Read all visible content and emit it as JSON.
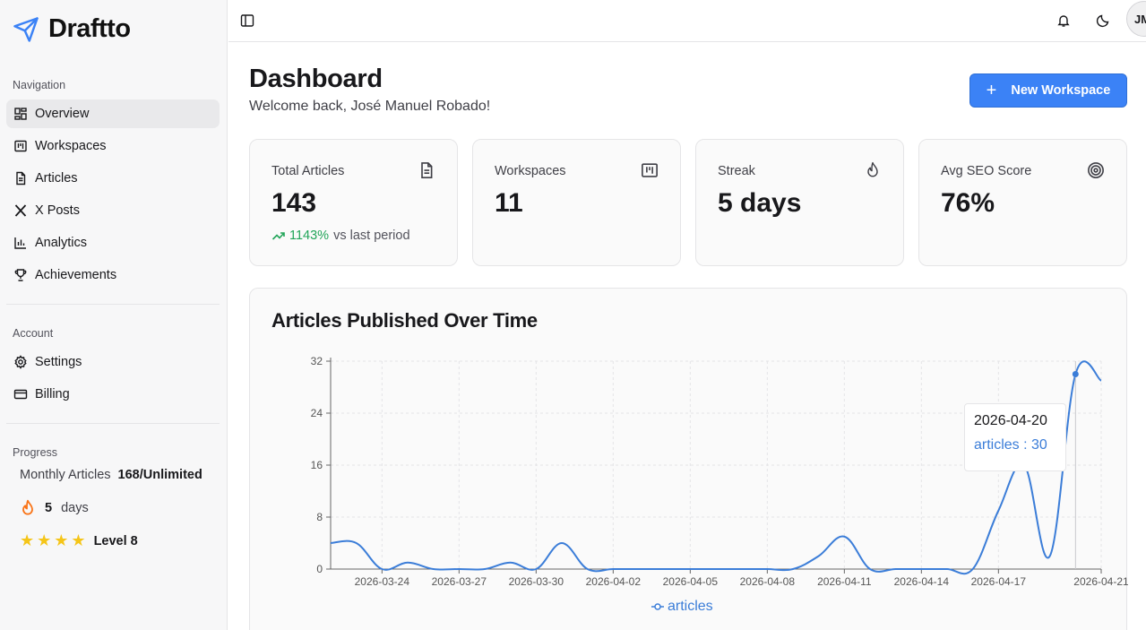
{
  "brand": {
    "name": "Draftto"
  },
  "sidebar": {
    "navigation_label": "Navigation",
    "nav": [
      {
        "label": "Overview",
        "icon": "grid-icon",
        "active": true
      },
      {
        "label": "Workspaces",
        "icon": "kanban-icon"
      },
      {
        "label": "Articles",
        "icon": "file-text-icon"
      },
      {
        "label": "X Posts",
        "icon": "x-logo-icon"
      },
      {
        "label": "Analytics",
        "icon": "bar-chart-icon"
      },
      {
        "label": "Achievements",
        "icon": "trophy-icon"
      }
    ],
    "account_label": "Account",
    "account": [
      {
        "label": "Settings",
        "icon": "gear-icon"
      },
      {
        "label": "Billing",
        "icon": "credit-card-icon"
      }
    ],
    "progress_label": "Progress",
    "progress": {
      "monthly_label": "Monthly Articles",
      "monthly_value": "168/Unlimited",
      "streak_value": "5",
      "streak_unit": "days",
      "level": "Level 8",
      "stars": 4
    }
  },
  "topbar": {
    "avatar_initials": "JM"
  },
  "header": {
    "title": "Dashboard",
    "welcome": "Welcome back, José Manuel Robado!",
    "new_button": "New Workspace"
  },
  "stats": [
    {
      "title": "Total Articles",
      "value": "143",
      "icon": "file-text-icon",
      "trend": "1143%",
      "trend_suffix": "vs last period"
    },
    {
      "title": "Workspaces",
      "value": "11",
      "icon": "kanban-icon"
    },
    {
      "title": "Streak",
      "value": "5 days",
      "icon": "flame-icon"
    },
    {
      "title": "Avg SEO Score",
      "value": "76%",
      "icon": "target-icon"
    }
  ],
  "chart": {
    "title": "Articles Published Over Time",
    "tooltip_date": "2026-04-20",
    "tooltip_value": "articles : 30",
    "legend": "articles"
  },
  "colors": {
    "accent": "#3b82f6",
    "line": "#3b7dd8",
    "trend_up": "#22a559",
    "star": "#f5c518"
  },
  "chart_data": {
    "type": "line",
    "title": "Articles Published Over Time",
    "x_tick_labels": [
      "2026-03-24",
      "2026-03-27",
      "2026-03-30",
      "2026-04-02",
      "2026-04-05",
      "2026-04-08",
      "2026-04-11",
      "2026-04-14",
      "2026-04-17",
      "2026-04-21"
    ],
    "y_ticks": [
      0,
      8,
      16,
      24,
      32
    ],
    "ylim": [
      0,
      32
    ],
    "grid": true,
    "legend_position": "bottom",
    "series": [
      {
        "name": "articles",
        "x": [
          "2026-03-22",
          "2026-03-23",
          "2026-03-24",
          "2026-03-25",
          "2026-03-26",
          "2026-03-27",
          "2026-03-28",
          "2026-03-29",
          "2026-03-30",
          "2026-03-31",
          "2026-04-01",
          "2026-04-02",
          "2026-04-03",
          "2026-04-04",
          "2026-04-05",
          "2026-04-06",
          "2026-04-07",
          "2026-04-08",
          "2026-04-09",
          "2026-04-10",
          "2026-04-11",
          "2026-04-12",
          "2026-04-13",
          "2026-04-14",
          "2026-04-15",
          "2026-04-16",
          "2026-04-17",
          "2026-04-18",
          "2026-04-19",
          "2026-04-20",
          "2026-04-21"
        ],
        "values": [
          4,
          4,
          0,
          1,
          0,
          0,
          0,
          1,
          0,
          4,
          0,
          0,
          0,
          0,
          0,
          0,
          0,
          0,
          0,
          2,
          5,
          0,
          0,
          0,
          0,
          0,
          9,
          16,
          2,
          30,
          29
        ]
      }
    ]
  }
}
